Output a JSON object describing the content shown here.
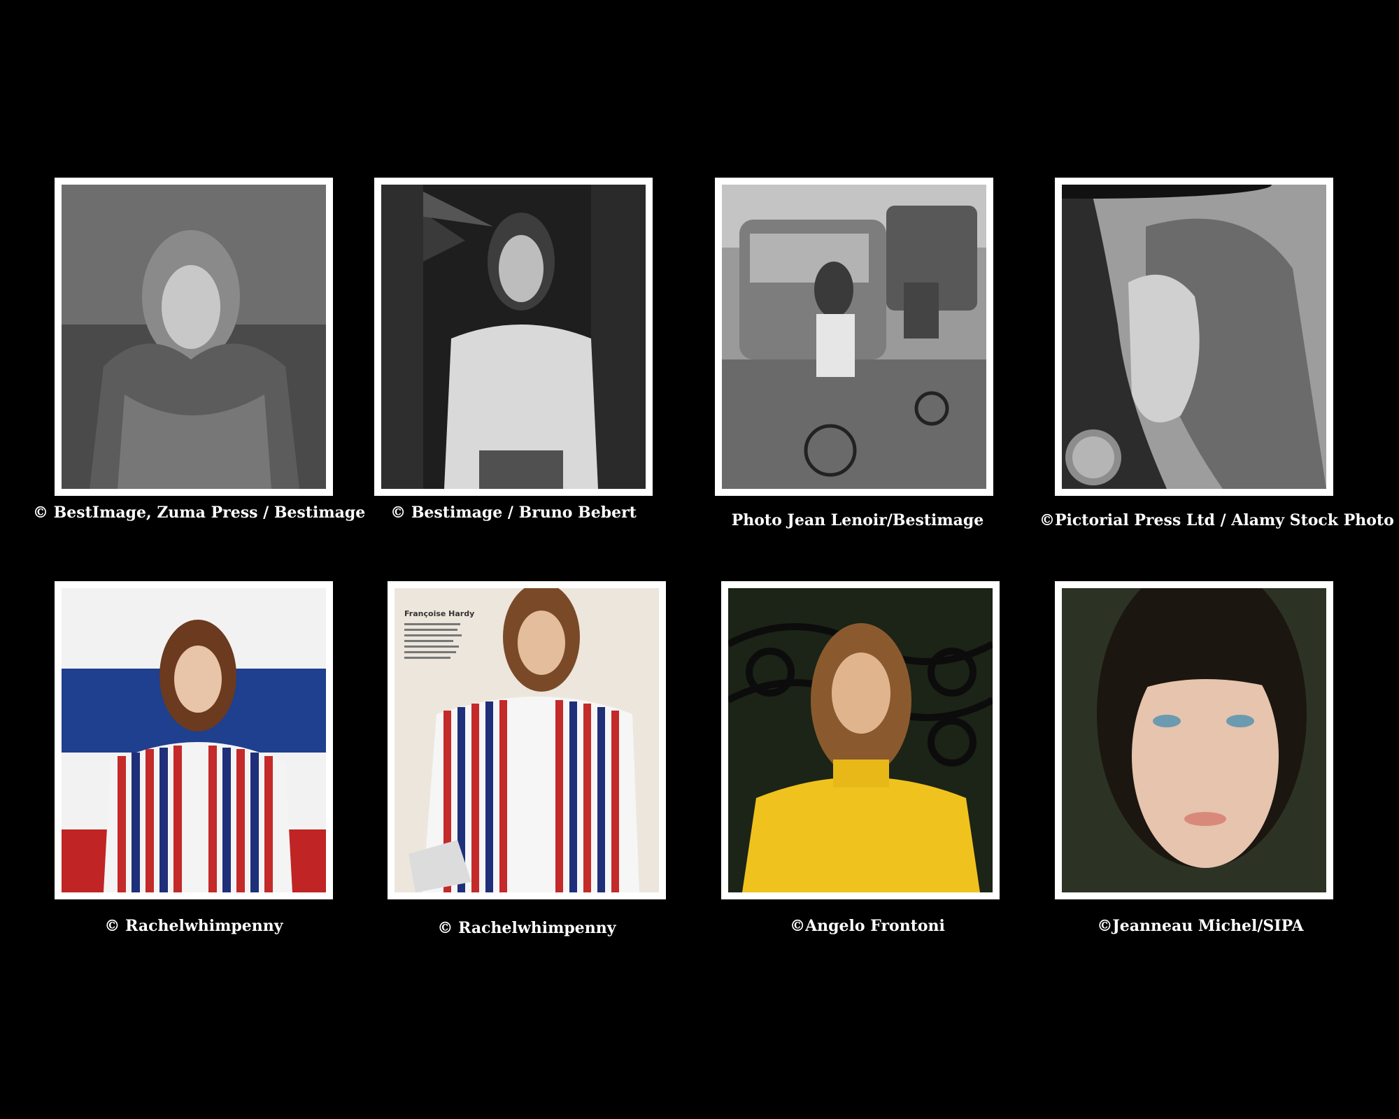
{
  "gallery": {
    "items": [
      {
        "caption": "© BestImage, Zuma Press / Bestimage",
        "palette": "monochrome"
      },
      {
        "caption": "© Bestimage / Bruno Bebert",
        "palette": "monochrome"
      },
      {
        "caption": "Photo Jean Lenoir/Bestimage",
        "palette": "monochrome"
      },
      {
        "caption": "©Pictorial Press Ltd / Alamy Stock Photo",
        "palette": "monochrome"
      },
      {
        "caption": "© Rachelwhimpenny",
        "palette": "color"
      },
      {
        "caption": "© Rachelwhimpenny",
        "palette": "color"
      },
      {
        "caption": "©Angelo Frontoni",
        "palette": "color"
      },
      {
        "caption": "©Jeanneau Michel/SIPA",
        "palette": "color"
      }
    ],
    "magazine_text": {
      "heading": "Françoise Hardy"
    }
  },
  "colors": {
    "background": "#000000",
    "frame": "#ffffff",
    "caption_text": "#ffffff"
  }
}
